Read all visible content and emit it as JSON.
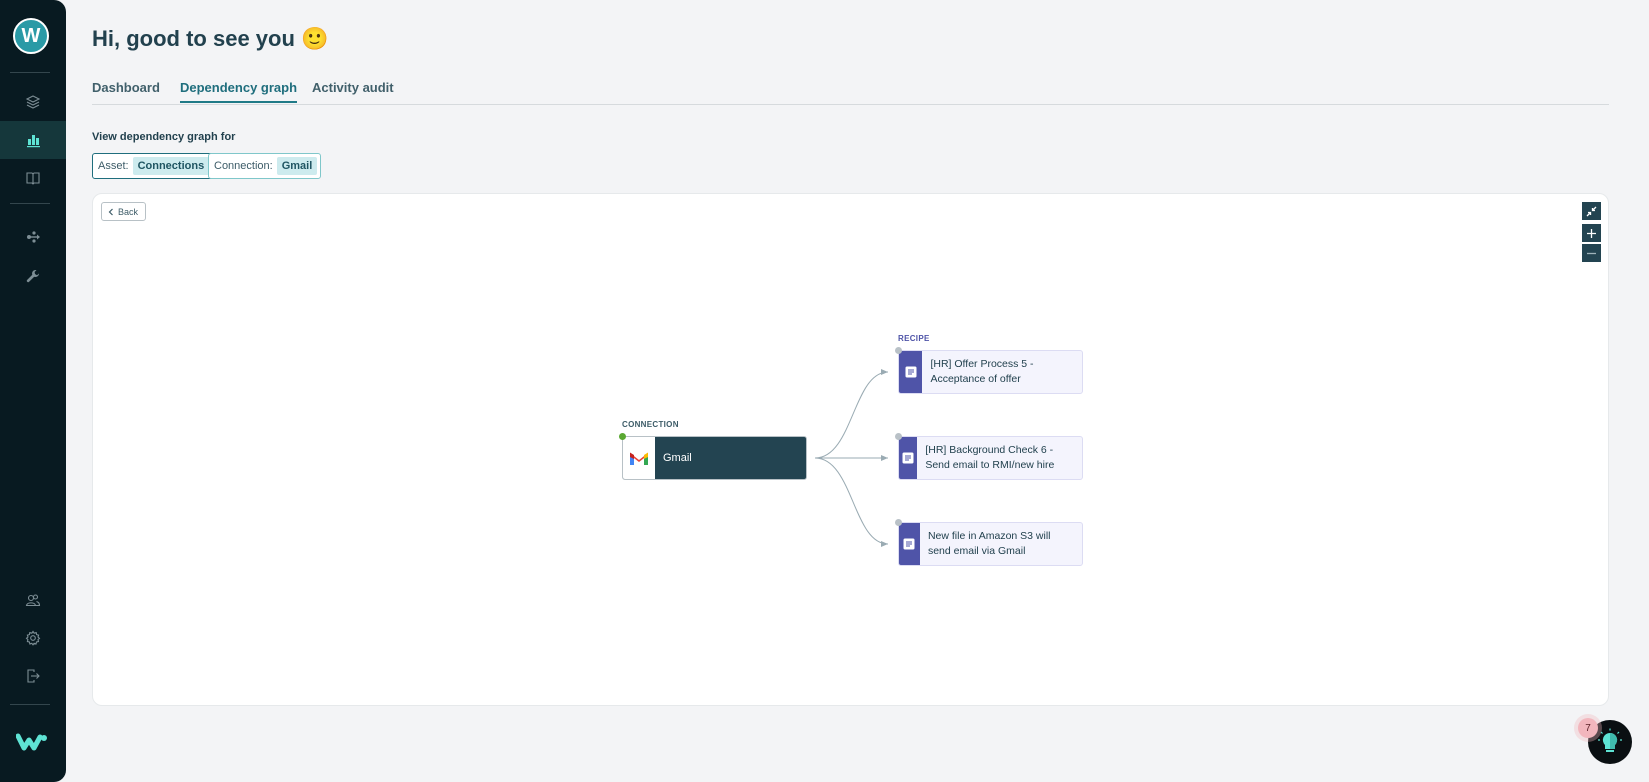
{
  "sidebar": {
    "logo_letter": "W",
    "items": [
      {
        "name": "assets",
        "icon": "layers-icon",
        "active": false
      },
      {
        "name": "dashboard",
        "icon": "bar-chart-icon",
        "active": true
      },
      {
        "name": "docs",
        "icon": "book-icon",
        "active": false
      },
      {
        "name": "tools",
        "icon": "connector-icon",
        "active": false
      },
      {
        "name": "settings-tools",
        "icon": "wrench-icon",
        "active": false
      }
    ],
    "bottom_items": [
      {
        "name": "team",
        "icon": "users-icon"
      },
      {
        "name": "settings",
        "icon": "gear-icon"
      },
      {
        "name": "logout",
        "icon": "logout-icon"
      }
    ],
    "accent": "#5ee3d4"
  },
  "header": {
    "greeting": "Hi, good to see you",
    "emoji": "🙂"
  },
  "tabs": [
    {
      "label": "Dashboard",
      "active": false
    },
    {
      "label": "Dependency graph",
      "active": true
    },
    {
      "label": "Activity audit",
      "active": false
    }
  ],
  "filter": {
    "label": "View dependency graph for",
    "chips": [
      {
        "key": "Asset:",
        "value": "Connections"
      },
      {
        "key": "Connection:",
        "value": "Gmail"
      }
    ]
  },
  "graph": {
    "back_label": "Back",
    "controls": [
      "collapse-icon",
      "zoom-in-icon",
      "zoom-out-icon"
    ],
    "source": {
      "type_label": "CONNECTION",
      "name": "Gmail",
      "icon": "gmail-icon",
      "status_color": "#5aa832"
    },
    "targets_type_label": "RECIPE",
    "targets": [
      {
        "name": "[HR] Offer Process 5 - Acceptance of offer"
      },
      {
        "name": "[HR] Background Check 6 - Send email to RMI/new hire"
      },
      {
        "name": "New file in Amazon S3 will send email via Gmail"
      }
    ]
  },
  "help": {
    "badge_count": "7"
  }
}
